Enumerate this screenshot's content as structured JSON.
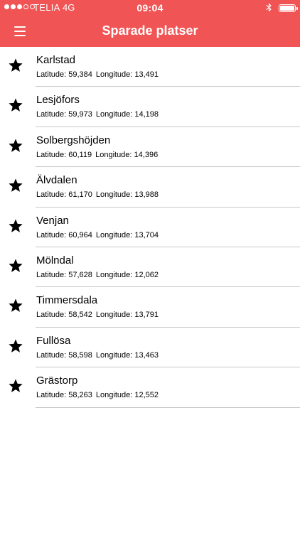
{
  "status_bar": {
    "carrier": "TELIA",
    "network": "4G",
    "time": "09:04"
  },
  "nav": {
    "title": "Sparade platser"
  },
  "labels": {
    "latitude": "Latitude:",
    "longitude": "Longitude:"
  },
  "places": [
    {
      "name": "Karlstad",
      "latitude": "59,384",
      "longitude": "13,491"
    },
    {
      "name": "Lesjöfors",
      "latitude": "59,973",
      "longitude": "14,198"
    },
    {
      "name": "Solbergshöjden",
      "latitude": "60,119",
      "longitude": "14,396"
    },
    {
      "name": "Älvdalen",
      "latitude": "61,170",
      "longitude": "13,988"
    },
    {
      "name": "Venjan",
      "latitude": "60,964",
      "longitude": "13,704"
    },
    {
      "name": "Mölndal",
      "latitude": "57,628",
      "longitude": "12,062"
    },
    {
      "name": "Timmersdala",
      "latitude": "58,542",
      "longitude": "13,791"
    },
    {
      "name": "Fullösa",
      "latitude": "58,598",
      "longitude": "13,463"
    },
    {
      "name": "Grästorp",
      "latitude": "58,263",
      "longitude": "12,552"
    }
  ],
  "colors": {
    "header": "#f05454",
    "separator": "#c8c7cc"
  },
  "icons": {
    "row": "star-icon",
    "menu": "hamburger-menu-icon"
  }
}
